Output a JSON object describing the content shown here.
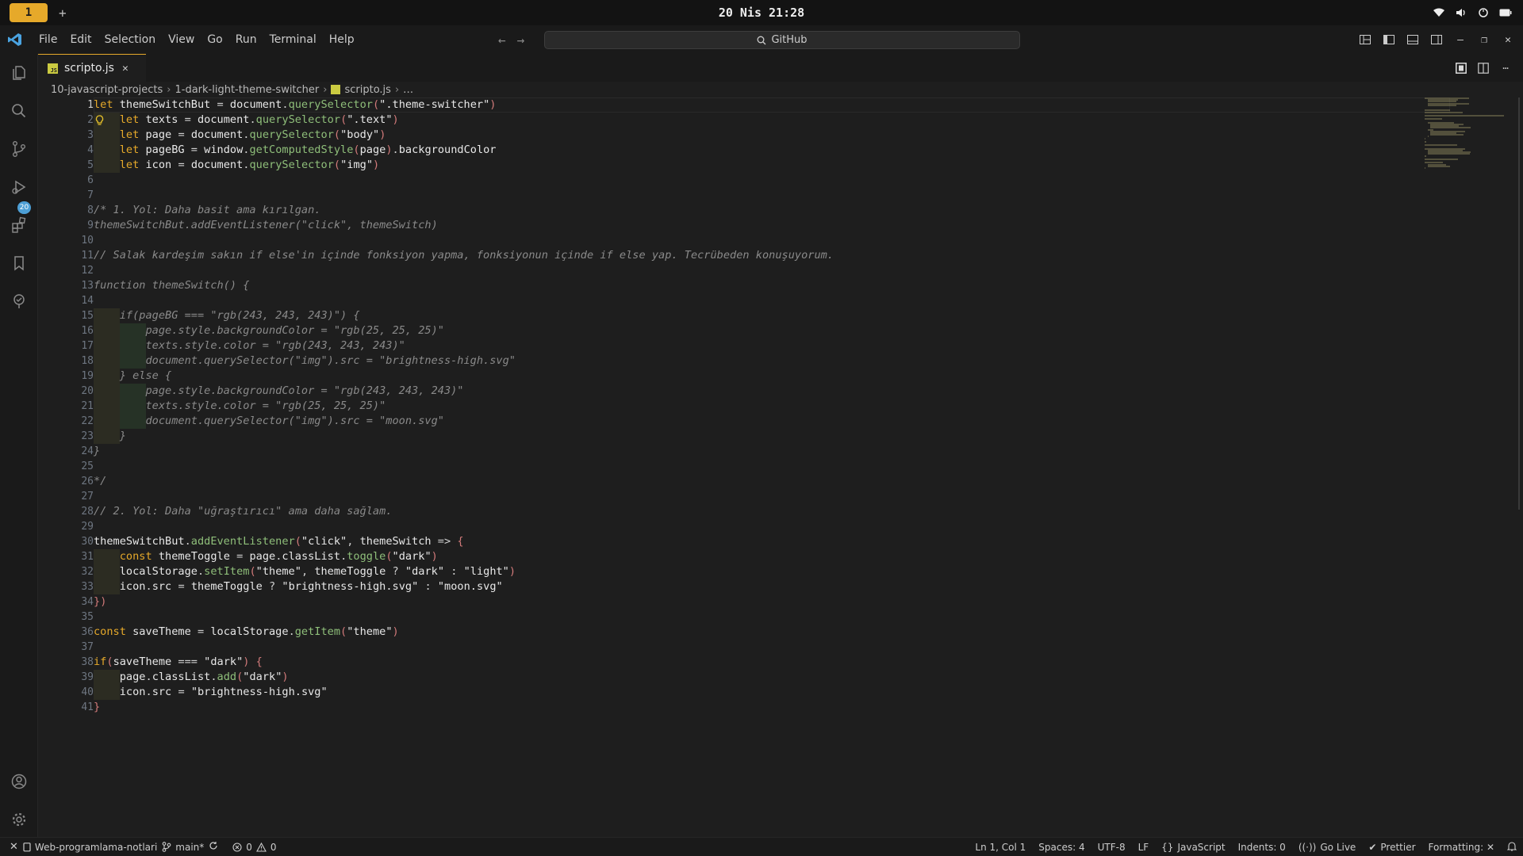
{
  "system": {
    "workspace": "1",
    "add": "+",
    "clock": "20 Nis 21:28"
  },
  "menu": {
    "items": [
      "File",
      "Edit",
      "Selection",
      "View",
      "Go",
      "Run",
      "Terminal",
      "Help"
    ],
    "search": "GitHub"
  },
  "activity": {
    "scm_badge": "20"
  },
  "tab": {
    "label": "scripto.js",
    "icon": "JS"
  },
  "breadcrumbs": {
    "items": [
      "10-javascript-projects",
      "1-dark-light-theme-switcher",
      "scripto.js",
      "…"
    ]
  },
  "editor": {
    "language": "JavaScript",
    "active_line": 1,
    "line_count": 41,
    "lines": [
      "let themeSwitchBut = document.querySelector(\".theme-switcher\")",
      "    let texts = document.querySelector(\".text\")",
      "    let page = document.querySelector(\"body\")",
      "    let pageBG = window.getComputedStyle(page).backgroundColor",
      "    let icon = document.querySelector(\"img\")",
      "",
      "",
      "/* 1. Yol: Daha basit ama kırılgan.",
      "themeSwitchBut.addEventListener(\"click\", themeSwitch)",
      "",
      "// Salak kardeşim sakın if else'in içinde fonksiyon yapma, fonksiyonun içinde if else yap. Tecrübeden konuşuyorum.",
      "",
      "function themeSwitch() {",
      "",
      "    if(pageBG === \"rgb(243, 243, 243)\") {",
      "        page.style.backgroundColor = \"rgb(25, 25, 25)\"",
      "        texts.style.color = \"rgb(243, 243, 243)\"",
      "        document.querySelector(\"img\").src = \"brightness-high.svg\"",
      "    } else {",
      "        page.style.backgroundColor = \"rgb(243, 243, 243)\"",
      "        texts.style.color = \"rgb(25, 25, 25)\"",
      "        document.querySelector(\"img\").src = \"moon.svg\"",
      "    }",
      "}",
      "",
      "*/",
      "",
      "// 2. Yol: Daha \"uğraştırıcı\" ama daha sağlam.",
      "",
      "themeSwitchBut.addEventListener(\"click\", themeSwitch => {",
      "    const themeToggle = page.classList.toggle(\"dark\")",
      "    localStorage.setItem(\"theme\", themeToggle ? \"dark\" : \"light\")",
      "    icon.src = themeToggle ? \"brightness-high.svg\" : \"moon.svg\"",
      "})",
      "",
      "const saveTheme = localStorage.getItem(\"theme\")",
      "",
      "if(saveTheme === \"dark\") {",
      "    page.classList.add(\"dark\")",
      "    icon.src = \"brightness-high.svg\"",
      "}"
    ]
  },
  "status": {
    "remote": "Web-programlama-notlari",
    "branch": "main*",
    "errors": "0",
    "warnings": "0",
    "position": "Ln 1, Col 1",
    "spaces": "Spaces: 4",
    "encoding": "UTF-8",
    "eol": "LF",
    "language": "JavaScript",
    "indents": "Indents: 0",
    "golive": "Go Live",
    "prettier": "Prettier",
    "formatting": "Formatting: ✕"
  },
  "colors": {
    "accent": "#e6a92a",
    "keyword": "#e6a92a",
    "function": "#8fbf7a",
    "comment": "#8a8a8a",
    "background": "#1e1e1e"
  }
}
